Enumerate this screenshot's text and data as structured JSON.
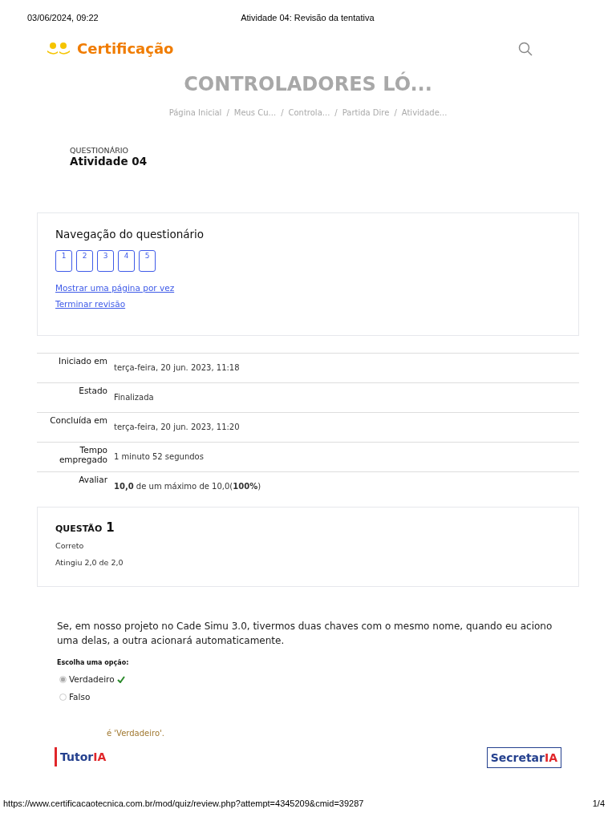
{
  "print_header": {
    "date": "03/06/2024, 09:22",
    "title": "Atividade 04: Revisão da tentativa"
  },
  "site": {
    "logo": "Certificação"
  },
  "course_title": "CONTROLADORES LÓ...",
  "breadcrumb_separator": "/",
  "breadcrumb": [
    "Página Inicial",
    "Meus Cu...",
    "Controla...",
    "Partida Dire",
    "Atividade..."
  ],
  "activity": {
    "type": "QUESTIONÁRIO",
    "name": "Atividade 04"
  },
  "navigation": {
    "title": "Navegação do questionário",
    "questions": [
      "1",
      "2",
      "3",
      "4",
      "5"
    ],
    "links": [
      "Mostrar uma página por vez",
      "Terminar revisão"
    ]
  },
  "summary": [
    {
      "label": "Iniciado em",
      "value": "terça-feira, 20 jun. 2023, 11:18"
    },
    {
      "label": "Estado",
      "value": "Finalizada"
    },
    {
      "label": "Concluída em",
      "value": "terça-feira, 20 jun. 2023, 11:20"
    },
    {
      "label": "Tempo empregado",
      "value": "1 minuto 52 segundos"
    },
    {
      "label": "Avaliar",
      "value": "**10,0** de um máximo de 10,0(**100%**)"
    }
  ],
  "question": {
    "label": "QUESTÃO",
    "number": "1",
    "status": "Correto",
    "grade": "Atingiu 2,0 de 2,0",
    "text": "Se, em nosso projeto no Cade Simu 3.0, tivermos duas chaves com o mesmo nome, quando eu aciono uma delas, a outra acionará automaticamente.",
    "prompt": "Escolha uma opção:",
    "options": [
      {
        "label": "Verdadeiro",
        "selected": true,
        "correct": true
      },
      {
        "label": "Falso",
        "selected": false,
        "correct": false
      }
    ],
    "feedback": "é 'Verdadeiro'."
  },
  "widgets": [
    {
      "prefix": "Tutor",
      "suffix": "IA"
    },
    {
      "prefix": "Secretar",
      "suffix": "IA"
    }
  ],
  "print_footer": {
    "url": "https://www.certificacaotecnica.com.br/mod/quiz/review.php?attempt=4345209&cmid=39287",
    "page": "1/4"
  }
}
